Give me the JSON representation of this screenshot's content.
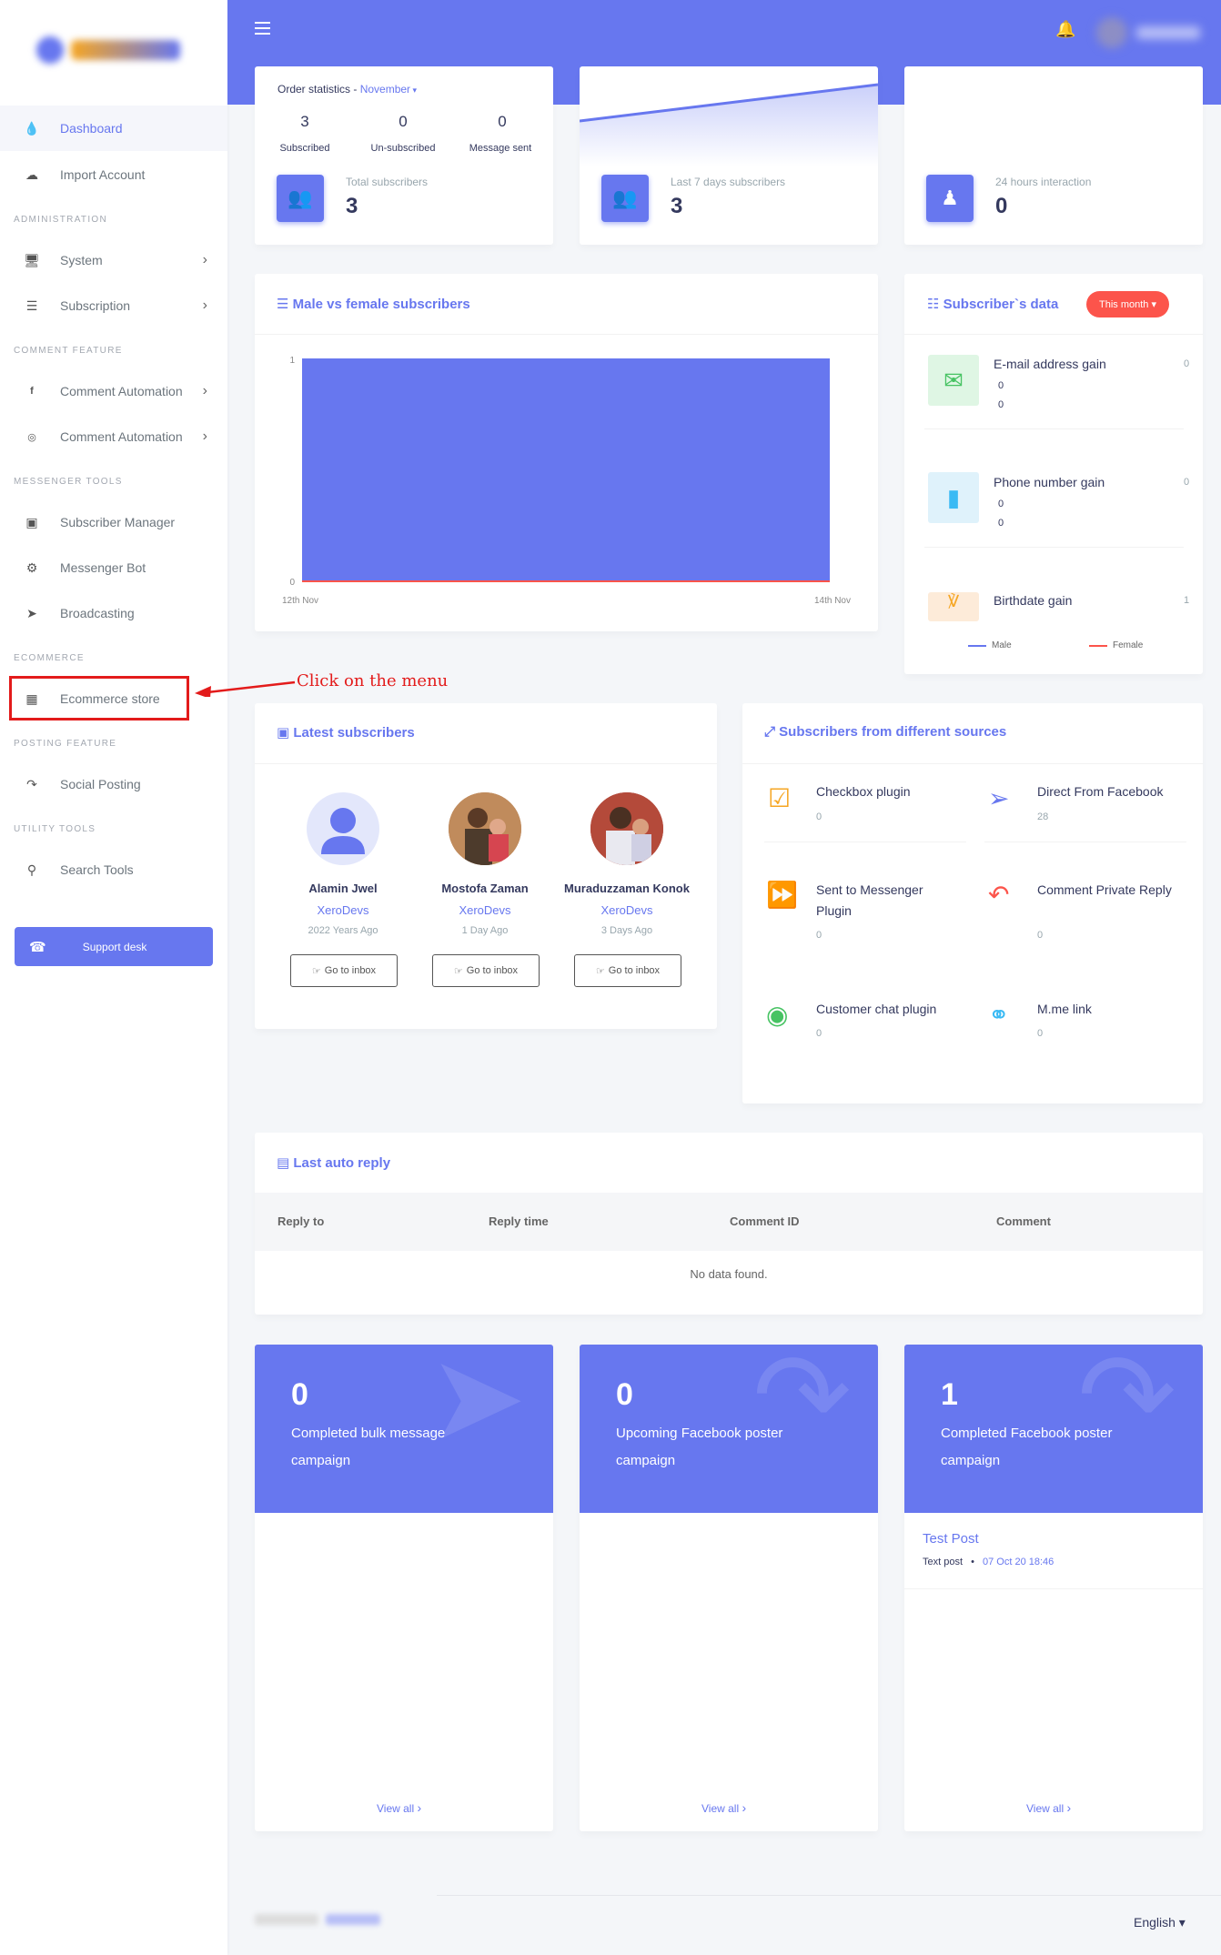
{
  "sidebar": {
    "items": [
      {
        "label": "Dashboard",
        "icon": "fire-icon"
      },
      {
        "label": "Import Account",
        "icon": "cloud-download-icon"
      },
      {
        "label": "System",
        "icon": "desktop-icon"
      },
      {
        "label": "Subscription",
        "icon": "coins-icon"
      },
      {
        "label": "Comment Automation",
        "icon": "facebook-square-icon"
      },
      {
        "label": "Comment Automation",
        "icon": "instagram-icon"
      },
      {
        "label": "Subscriber Manager",
        "icon": "address-book-icon"
      },
      {
        "label": "Messenger Bot",
        "icon": "robot-icon"
      },
      {
        "label": "Broadcasting",
        "icon": "paper-plane-icon"
      },
      {
        "label": "Ecommerce store",
        "icon": "store-icon"
      },
      {
        "label": "Social Posting",
        "icon": "share-square-icon"
      },
      {
        "label": "Search Tools",
        "icon": "search-icon"
      }
    ],
    "headers": [
      "ADMINISTRATION",
      "COMMENT FEATURE",
      "MESSENGER TOOLS",
      "ECOMMERCE",
      "POSTING FEATURE",
      "UTILITY TOOLS"
    ],
    "support_label": "Support desk"
  },
  "annotation": {
    "label": "Click on the menu"
  },
  "order_stats": {
    "title": "Order statistics",
    "month": "November",
    "stats": [
      {
        "value": "3",
        "label": "Subscribed"
      },
      {
        "value": "0",
        "label": "Un-subscribed"
      },
      {
        "value": "0",
        "label": "Message sent"
      }
    ],
    "total_label": "Total subscribers",
    "total_value": "3"
  },
  "last7": {
    "label": "Last 7 days subscribers",
    "value": "3"
  },
  "interaction": {
    "label": "24 hours interaction",
    "value": "0"
  },
  "gender_chart": {
    "title": "Male vs female subscribers",
    "legend_male": "Male",
    "legend_female": "Female"
  },
  "chart_data": {
    "type": "area",
    "title": "Male vs female subscribers",
    "x": [
      "12th Nov",
      "14th Nov"
    ],
    "yticks": [
      0,
      1
    ],
    "ylim": [
      0,
      1
    ],
    "series": [
      {
        "name": "Male",
        "values": [
          1,
          1
        ],
        "color": "#6777ef"
      },
      {
        "name": "Female",
        "values": [
          0,
          0
        ],
        "color": "#fc544b"
      }
    ],
    "legend": "bottom"
  },
  "subscriber_data": {
    "title": "Subscriber`s data",
    "filter_label": "This month",
    "rows": [
      {
        "title": "E-mail address gain",
        "right": "0",
        "v1": "0",
        "v2": "0",
        "icon": "envelope-icon"
      },
      {
        "title": "Phone number gain",
        "right": "0",
        "v1": "0",
        "v2": "0",
        "icon": "mobile-icon"
      },
      {
        "title": "Birthdate gain",
        "right": "1",
        "icon": "birthday-cake-icon"
      }
    ]
  },
  "latest_subscribers": {
    "title": "Latest subscribers",
    "people": [
      {
        "name": "Alamin Jwel",
        "org": "XeroDevs",
        "time": "2022 Years Ago",
        "button": "Go to inbox"
      },
      {
        "name": "Mostofa Zaman",
        "org": "XeroDevs",
        "time": "1 Day Ago",
        "button": "Go to inbox"
      },
      {
        "name": "Muraduzzaman Konok",
        "org": "XeroDevs",
        "time": "3 Days Ago",
        "button": "Go to inbox"
      }
    ]
  },
  "sources": {
    "title": "Subscribers from different sources",
    "items": [
      {
        "title": "Checkbox plugin",
        "value": "0",
        "icon": "check-square-icon",
        "color": "#f6a623"
      },
      {
        "title": "Direct From Facebook",
        "value": "28",
        "icon": "directions-icon",
        "color": "#6777ef"
      },
      {
        "title": "Sent to Messenger Plugin",
        "value": "0",
        "icon": "forward-icon",
        "color": "#7b3fe4"
      },
      {
        "title": "Comment Private Reply",
        "value": "0",
        "icon": "reply-all-icon",
        "color": "#fc544b"
      },
      {
        "title": "Customer chat plugin",
        "value": "0",
        "icon": "comments-icon",
        "color": "#47c363"
      },
      {
        "title": "M.me link",
        "value": "0",
        "icon": "link-icon",
        "color": "#3abaf4"
      }
    ]
  },
  "auto_reply": {
    "title": "Last auto reply",
    "columns": [
      "Reply to",
      "Reply time",
      "Comment ID",
      "Comment"
    ],
    "empty": "No data found."
  },
  "campaigns": [
    {
      "value": "0",
      "label": "Completed bulk message campaign",
      "icon": "paper-plane-icon",
      "view_all": "View all"
    },
    {
      "value": "0",
      "label": "Upcoming Facebook poster campaign",
      "icon": "share-square-icon",
      "view_all": "View all"
    },
    {
      "value": "1",
      "label": "Completed Facebook poster campaign",
      "icon": "share-square-icon",
      "view_all": "View all",
      "post_title": "Test Post",
      "post_type": "Text post",
      "post_time": "07 Oct 20 18:46"
    }
  ],
  "footer": {
    "language": "English"
  },
  "colors": {
    "primary": "#6777ef",
    "danger": "#fc544b",
    "annotation": "#e31b1b"
  }
}
